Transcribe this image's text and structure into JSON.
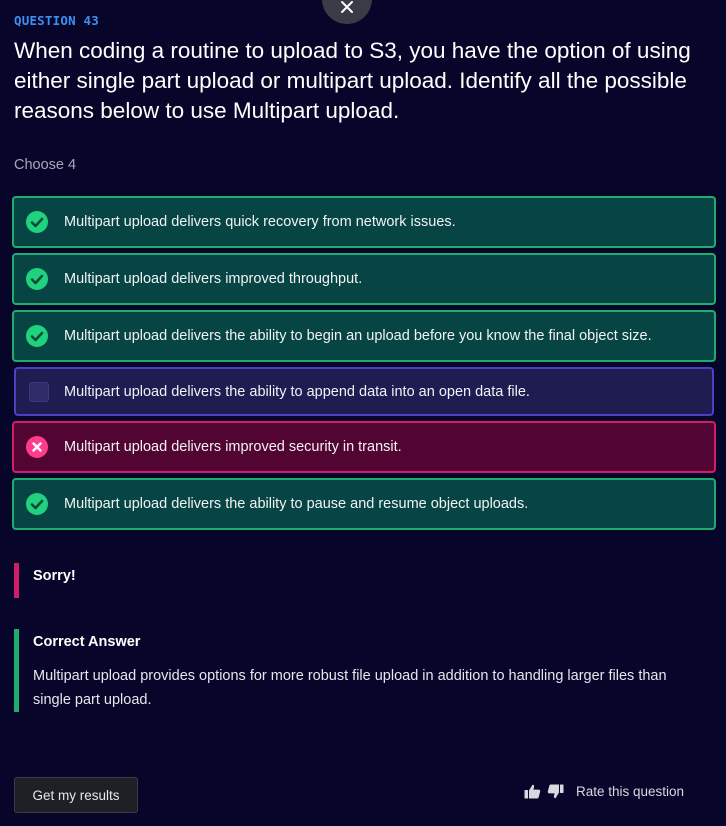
{
  "question": {
    "label": "QUESTION 43",
    "text": "When coding a routine to upload to S3, you have the option of using either single part upload or multipart upload. Identify all the possible reasons below to use Multipart upload.",
    "instruction": "Choose 4"
  },
  "options": [
    {
      "text": "Multipart upload delivers quick recovery from network issues.",
      "state": "correct",
      "icon": "check-circle-icon"
    },
    {
      "text": "Multipart upload delivers improved throughput.",
      "state": "correct",
      "icon": "check-circle-icon"
    },
    {
      "text": "Multipart upload delivers the ability to begin an upload before you know the final object size.",
      "state": "correct",
      "icon": "check-circle-icon"
    },
    {
      "text": "Multipart upload delivers the ability to append data into an open data file.",
      "state": "unselected",
      "icon": "empty-checkbox-icon"
    },
    {
      "text": "Multipart upload delivers improved security in transit.",
      "state": "wrong",
      "icon": "x-circle-icon"
    },
    {
      "text": "Multipart upload delivers the ability to pause and resume object uploads.",
      "state": "correct",
      "icon": "check-circle-icon"
    }
  ],
  "feedback": {
    "result": "Sorry!",
    "correct_title": "Correct Answer",
    "correct_text": "Multipart upload provides options for more robust file upload in addition to handling larger files than single part upload."
  },
  "footer": {
    "results_button": "Get my results",
    "rate_label": "Rate this question"
  },
  "colors": {
    "background": "#07062a",
    "question_label": "#3d8ff0",
    "correct": "#1fad6e",
    "wrong": "#d01d6a",
    "neutral": "#4b42c3"
  }
}
